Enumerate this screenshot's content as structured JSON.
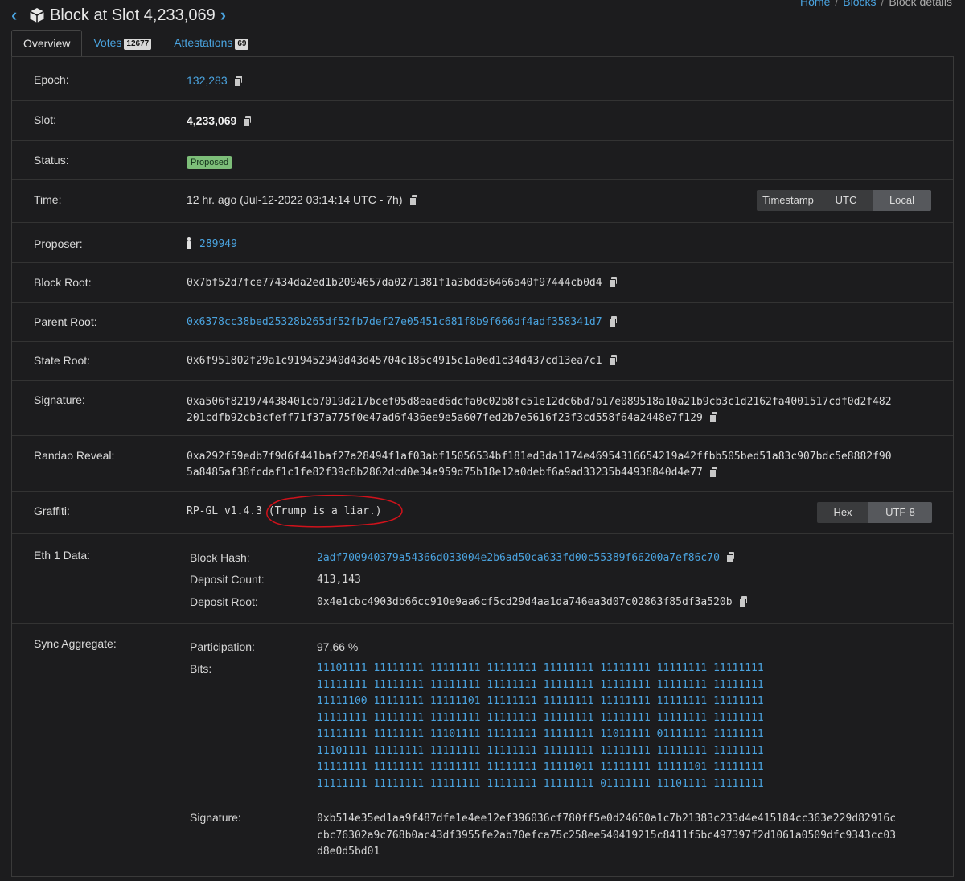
{
  "header": {
    "title": "Block at Slot 4,233,069",
    "prev_icon": "chevron-left-icon",
    "next_icon": "chevron-right-icon",
    "block_icon": "cube-icon"
  },
  "breadcrumb": {
    "home": "Home",
    "sep": "/",
    "blocks": "Blocks",
    "current": "Block details"
  },
  "tabs": [
    {
      "label": "Overview",
      "count": ""
    },
    {
      "label": "Votes",
      "count": "12677"
    },
    {
      "label": "Attestations",
      "count": "69"
    }
  ],
  "fields": {
    "epoch": {
      "label": "Epoch:",
      "value": "132,283"
    },
    "slot": {
      "label": "Slot:",
      "value": "4,233,069"
    },
    "status": {
      "label": "Status:",
      "value": "Proposed"
    },
    "time": {
      "label": "Time:",
      "value": "12 hr. ago (Jul-12-2022 03:14:14 UTC - 7h)",
      "options": [
        "Timestamp",
        "UTC",
        "Local"
      ],
      "selected": "Local"
    },
    "proposer": {
      "label": "Proposer:",
      "value": "289949"
    },
    "block_root": {
      "label": "Block Root:",
      "value": "0x7bf52d7fce77434da2ed1b2094657da0271381f1a3bdd36466a40f97444cb0d4"
    },
    "parent_root": {
      "label": "Parent Root:",
      "value": "0x6378cc38bed25328b265df52fb7def27e05451c681f8b9f666df4adf358341d7"
    },
    "state_root": {
      "label": "State Root:",
      "value": "0x6f951802f29a1c919452940d43d45704c185c4915c1a0ed1c34d437cd13ea7c1"
    },
    "signature": {
      "label": "Signature:",
      "line1": "0xa506f821974438401cb7019d217bcef05d8eaed6dcfa0c02b8fc51e12dc6bd7b17e089518a10a21b9cb3c1d2162fa4001517cdf0d2f482",
      "line2": "201cdfb92cb3cfeff71f37a775f0e47ad6f436ee9e5a607fed2b7e5616f23f3cd558f64a2448e7f129"
    },
    "randao": {
      "label": "Randao Reveal:",
      "line1": "0xa292f59edb7f9d6f441baf27a28494f1af03abf15056534bf181ed3da1174e46954316654219a42ffbb505bed51a83c907bdc5e8882f90",
      "line2": "5a8485af38fcdaf1c1fe82f39c8b2862dcd0e34a959d75b18e12a0debf6a9ad33235b44938840d4e77"
    },
    "graffiti": {
      "label": "Graffiti:",
      "value": "RP-GL v1.4.3 (Trump is a liar.)",
      "options": [
        "Hex",
        "UTF-8"
      ],
      "selected": "UTF-8"
    },
    "eth1": {
      "label": "Eth 1 Data:",
      "block_hash_label": "Block Hash:",
      "block_hash": "2adf700940379a54366d033004e2b6ad50ca633fd00c55389f66200a7ef86c70",
      "deposit_count_label": "Deposit Count:",
      "deposit_count": "413,143",
      "deposit_root_label": "Deposit Root:",
      "deposit_root": "0x4e1cbc4903db66cc910e9aa6cf5cd29d4aa1da746ea3d07c02863f85df3a520b"
    },
    "sync": {
      "label": "Sync Aggregate:",
      "participation_label": "Participation:",
      "participation": "97.66 %",
      "bits_label": "Bits:",
      "bits": [
        "11101111 11111111 11111111 11111111 11111111 11111111 11111111 11111111",
        "11111111 11111111 11111111 11111111 11111111 11111111 11111111 11111111",
        "11111100 11111111 11111101 11111111 11111111 11111111 11111111 11111111",
        "11111111 11111111 11111111 11111111 11111111 11111111 11111111 11111111",
        "11111111 11111111 11101111 11111111 11111111 11011111 01111111 11111111",
        "11101111 11111111 11111111 11111111 11111111 11111111 11111111 11111111",
        "11111111 11111111 11111111 11111111 11111011 11111111 11111101 11111111",
        "11111111 11111111 11111111 11111111 11111111 01111111 11101111 11111111"
      ],
      "signature_label": "Signature:",
      "signature_lines": [
        "0xb514e35ed1aa9f487dfe1e4ee12ef396036cf780ff5e0d24650a1c7b21383c233d4e415184cc363e229d82916c",
        "cbc76302a9c768b0ac43df3955fe2ab70efca75c258ee540419215c8411f5bc497397f2d1061a0509dfc9343cc03",
        "d8e0d5bd01"
      ]
    }
  },
  "colors": {
    "link": "#4aa3df",
    "background": "#1c1c1e",
    "badge_green": "#7dbe79",
    "annotation_red": "#d0121b"
  }
}
